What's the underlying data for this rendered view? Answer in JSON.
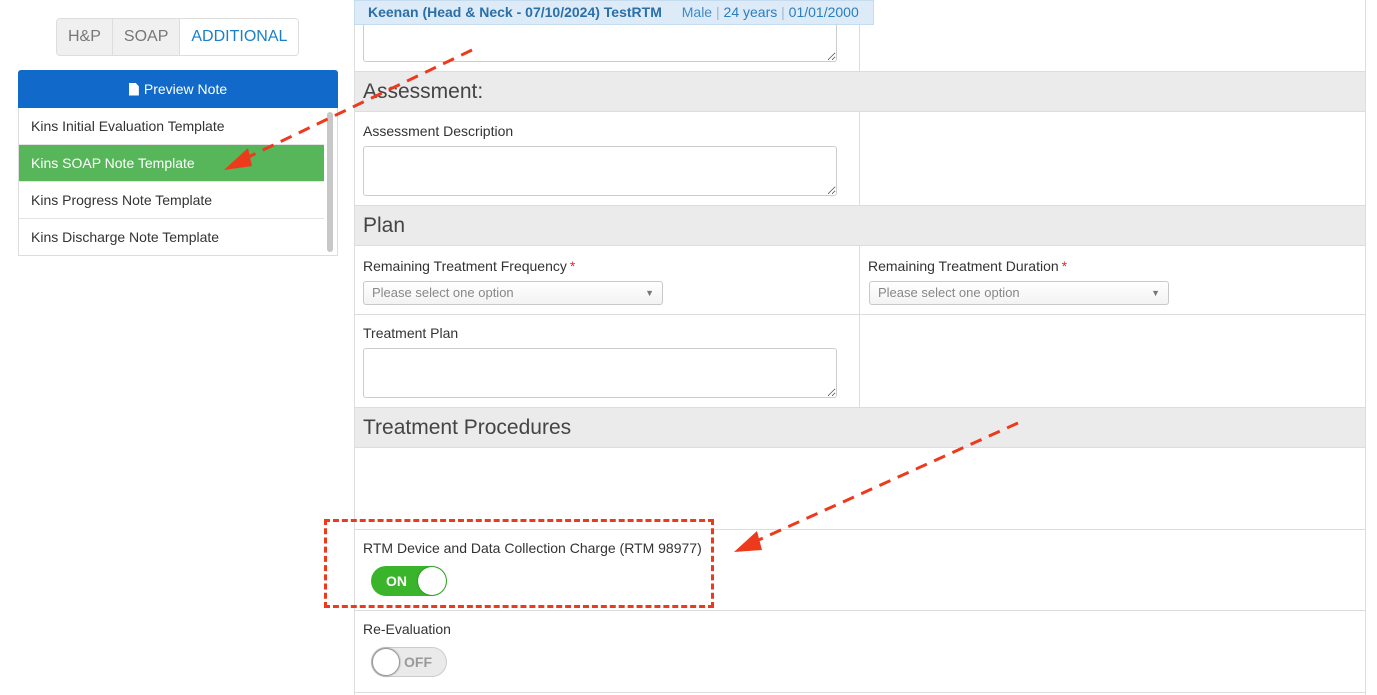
{
  "tabs": [
    {
      "label": "H&P"
    },
    {
      "label": "SOAP"
    },
    {
      "label": "ADDITIONAL"
    }
  ],
  "preview_button": {
    "label": "Preview Note",
    "icon": "file-icon"
  },
  "templates": [
    {
      "label": "Kins Initial Evaluation Template"
    },
    {
      "label": "Kins SOAP Note Template"
    },
    {
      "label": "Kins Progress Note Template"
    },
    {
      "label": "Kins Discharge Note Template"
    }
  ],
  "patient": {
    "name": "Keenan (Head & Neck - 07/10/2024) TestRTM",
    "sex": "Male",
    "age": "24 years",
    "dob": "01/01/2000",
    "separator": "|"
  },
  "form": {
    "assessment_header": "Assessment:",
    "assessment_description_label": "Assessment Description",
    "plan_header": "Plan",
    "frequency_label": "Remaining Treatment Frequency",
    "frequency_placeholder": "Please select one option",
    "duration_label": "Remaining Treatment Duration",
    "duration_placeholder": "Please select one option",
    "required_mark": "*",
    "treatment_plan_label": "Treatment Plan",
    "procedures_header": "Treatment Procedures",
    "rtm_label": "RTM Device and Data Collection Charge (RTM 98977)",
    "rtm_toggle": "ON",
    "reeval_label": "Re-Evaluation",
    "reeval_toggle": "OFF"
  },
  "colors": {
    "primary_blue": "#1169c9",
    "active_template_green": "#57b55a",
    "toggle_on_green": "#3ab52b",
    "annotation_red": "#ee3a1c"
  }
}
